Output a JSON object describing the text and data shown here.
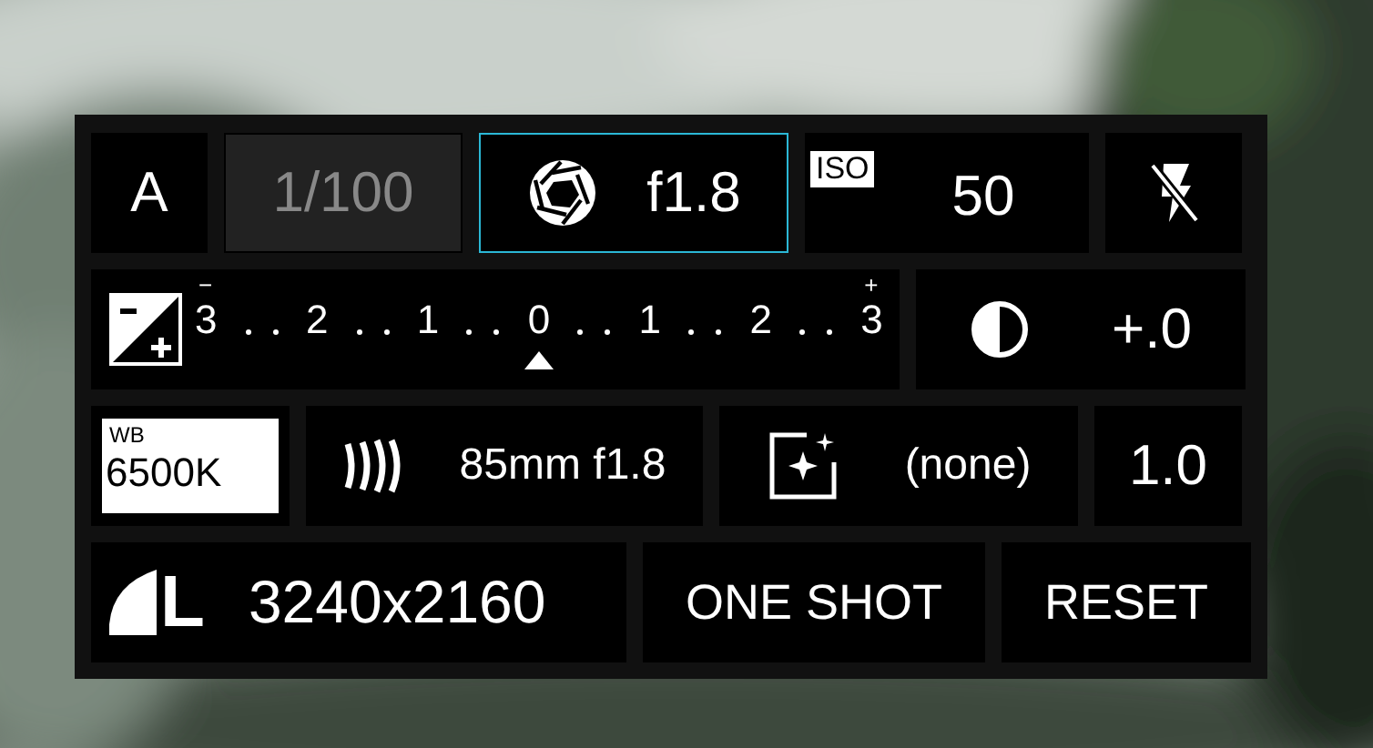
{
  "rows": [
    [
      {
        "kind": "mode",
        "value": "A",
        "selected": false,
        "disabled": false
      },
      {
        "kind": "shutter",
        "value": "1/100",
        "selected": false,
        "disabled": true
      },
      {
        "kind": "aperture",
        "value": "f1.8",
        "selected": true,
        "disabled": false
      },
      {
        "kind": "iso",
        "badge": "ISO",
        "value": "50",
        "selected": false,
        "disabled": false
      },
      {
        "kind": "flash",
        "selected": false,
        "disabled": false
      }
    ],
    [
      {
        "kind": "exposure",
        "minus": "−",
        "plus": "+",
        "ticks": [
          "3",
          "2",
          "1",
          "0",
          "1",
          "2",
          "3"
        ],
        "level": 0.5,
        "selected": false,
        "disabled": false
      },
      {
        "kind": "contrast",
        "value": "+.0",
        "selected": false,
        "disabled": false
      }
    ],
    [
      {
        "kind": "wb",
        "badge": "WB",
        "value": "6500K",
        "selected": false,
        "disabled": false
      },
      {
        "kind": "lens",
        "value": "85mm f1.8",
        "selected": false,
        "disabled": false
      },
      {
        "kind": "style",
        "value": "(none)",
        "selected": false,
        "disabled": false
      },
      {
        "kind": "number",
        "value": "1.0",
        "selected": false,
        "disabled": false
      }
    ],
    [
      {
        "kind": "size",
        "size_label": "L",
        "value": "3240x2160",
        "selected": false,
        "disabled": false
      },
      {
        "kind": "button",
        "value": "ONE SHOT",
        "selected": false,
        "disabled": false
      },
      {
        "kind": "button",
        "value": "RESET",
        "selected": false,
        "disabled": false
      }
    ]
  ]
}
